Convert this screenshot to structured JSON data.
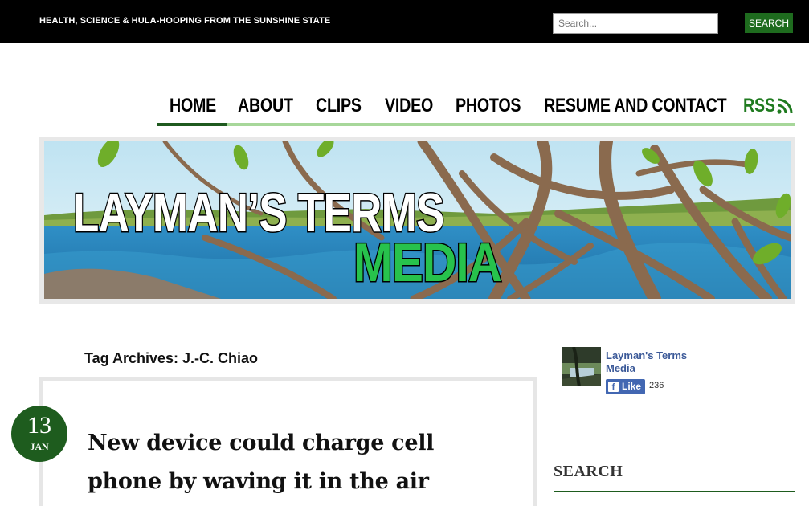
{
  "header": {
    "tagline": "HEALTH, SCIENCE & HULA-HOOPING FROM THE SUNSHINE STATE",
    "search_placeholder": "Search...",
    "search_button": "SEARCH"
  },
  "nav": {
    "items": [
      {
        "label": "HOME",
        "active": true
      },
      {
        "label": "ABOUT"
      },
      {
        "label": "CLIPS"
      },
      {
        "label": "VIDEO"
      },
      {
        "label": "PHOTOS"
      },
      {
        "label": "RESUME AND CONTACT"
      },
      {
        "label": "RSS"
      }
    ]
  },
  "banner": {
    "line1": "LAYMAN’S TERMS",
    "line2": "MEDIA"
  },
  "archive": {
    "title": "Tag Archives: J.-C. Chiao"
  },
  "post": {
    "day": "13",
    "month": "JAN",
    "title": "New device could charge cell phone by waving it in the air"
  },
  "sidebar": {
    "fb_page_name": "Layman's Terms Media",
    "fb_like_label": "Like",
    "fb_like_count": "236",
    "search_heading": "SEARCH"
  },
  "colors": {
    "topbar": "#000000",
    "accent_green": "#1e5c1e",
    "nav_underline": "#a7d79a",
    "facebook_blue": "#4267b2"
  }
}
